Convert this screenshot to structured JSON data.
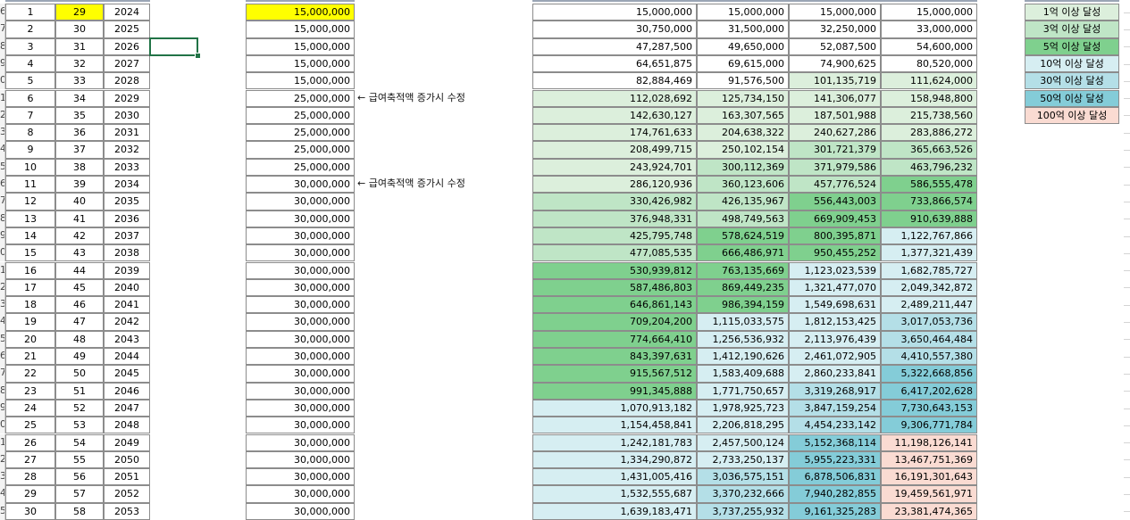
{
  "sheet": {
    "rows": [
      {
        "header": "6",
        "n": "1",
        "age": "29",
        "year": "2024",
        "amount": "15,000,000",
        "a": "15,000,000",
        "b": "15,000,000",
        "c": "15,000,000",
        "d": "15,000,000"
      },
      {
        "header": "7",
        "n": "2",
        "age": "30",
        "year": "2025",
        "amount": "15,000,000",
        "a": "30,750,000",
        "b": "31,500,000",
        "c": "32,250,000",
        "d": "33,000,000"
      },
      {
        "header": "8",
        "n": "3",
        "age": "31",
        "year": "2026",
        "amount": "15,000,000",
        "a": "47,287,500",
        "b": "49,650,000",
        "c": "52,087,500",
        "d": "54,600,000"
      },
      {
        "header": "9",
        "n": "4",
        "age": "32",
        "year": "2027",
        "amount": "15,000,000",
        "a": "64,651,875",
        "b": "69,615,000",
        "c": "74,900,625",
        "d": "80,520,000"
      },
      {
        "header": "0",
        "n": "5",
        "age": "33",
        "year": "2028",
        "amount": "15,000,000",
        "a": "82,884,469",
        "b": "91,576,500",
        "c": "101,135,719",
        "d": "111,624,000"
      },
      {
        "header": "1",
        "n": "6",
        "age": "34",
        "year": "2029",
        "amount": "25,000,000",
        "a": "112,028,692",
        "b": "125,734,150",
        "c": "141,306,077",
        "d": "158,948,800"
      },
      {
        "header": "2",
        "n": "7",
        "age": "35",
        "year": "2030",
        "amount": "25,000,000",
        "a": "142,630,127",
        "b": "163,307,565",
        "c": "187,501,988",
        "d": "215,738,560"
      },
      {
        "header": "3",
        "n": "8",
        "age": "36",
        "year": "2031",
        "amount": "25,000,000",
        "a": "174,761,633",
        "b": "204,638,322",
        "c": "240,627,286",
        "d": "283,886,272"
      },
      {
        "header": "4",
        "n": "9",
        "age": "37",
        "year": "2032",
        "amount": "25,000,000",
        "a": "208,499,715",
        "b": "250,102,154",
        "c": "301,721,379",
        "d": "365,663,526"
      },
      {
        "header": "5",
        "n": "10",
        "age": "38",
        "year": "2033",
        "amount": "25,000,000",
        "a": "243,924,701",
        "b": "300,112,369",
        "c": "371,979,586",
        "d": "463,796,232"
      },
      {
        "header": "6",
        "n": "11",
        "age": "39",
        "year": "2034",
        "amount": "30,000,000",
        "a": "286,120,936",
        "b": "360,123,606",
        "c": "457,776,524",
        "d": "586,555,478"
      },
      {
        "header": "7",
        "n": "12",
        "age": "40",
        "year": "2035",
        "amount": "30,000,000",
        "a": "330,426,982",
        "b": "426,135,967",
        "c": "556,443,003",
        "d": "733,866,574"
      },
      {
        "header": "8",
        "n": "13",
        "age": "41",
        "year": "2036",
        "amount": "30,000,000",
        "a": "376,948,331",
        "b": "498,749,563",
        "c": "669,909,453",
        "d": "910,639,888"
      },
      {
        "header": "9",
        "n": "14",
        "age": "42",
        "year": "2037",
        "amount": "30,000,000",
        "a": "425,795,748",
        "b": "578,624,519",
        "c": "800,395,871",
        "d": "1,122,767,866"
      },
      {
        "header": "0",
        "n": "15",
        "age": "43",
        "year": "2038",
        "amount": "30,000,000",
        "a": "477,085,535",
        "b": "666,486,971",
        "c": "950,455,252",
        "d": "1,377,321,439"
      },
      {
        "header": "1",
        "n": "16",
        "age": "44",
        "year": "2039",
        "amount": "30,000,000",
        "a": "530,939,812",
        "b": "763,135,669",
        "c": "1,123,023,539",
        "d": "1,682,785,727"
      },
      {
        "header": "2",
        "n": "17",
        "age": "45",
        "year": "2040",
        "amount": "30,000,000",
        "a": "587,486,803",
        "b": "869,449,235",
        "c": "1,321,477,070",
        "d": "2,049,342,872"
      },
      {
        "header": "3",
        "n": "18",
        "age": "46",
        "year": "2041",
        "amount": "30,000,000",
        "a": "646,861,143",
        "b": "986,394,159",
        "c": "1,549,698,631",
        "d": "2,489,211,447"
      },
      {
        "header": "4",
        "n": "19",
        "age": "47",
        "year": "2042",
        "amount": "30,000,000",
        "a": "709,204,200",
        "b": "1,115,033,575",
        "c": "1,812,153,425",
        "d": "3,017,053,736"
      },
      {
        "header": "5",
        "n": "20",
        "age": "48",
        "year": "2043",
        "amount": "30,000,000",
        "a": "774,664,410",
        "b": "1,256,536,932",
        "c": "2,113,976,439",
        "d": "3,650,464,484"
      },
      {
        "header": "6",
        "n": "21",
        "age": "49",
        "year": "2044",
        "amount": "30,000,000",
        "a": "843,397,631",
        "b": "1,412,190,626",
        "c": "2,461,072,905",
        "d": "4,410,557,380"
      },
      {
        "header": "7",
        "n": "22",
        "age": "50",
        "year": "2045",
        "amount": "30,000,000",
        "a": "915,567,512",
        "b": "1,583,409,688",
        "c": "2,860,233,841",
        "d": "5,322,668,856"
      },
      {
        "header": "8",
        "n": "23",
        "age": "51",
        "year": "2046",
        "amount": "30,000,000",
        "a": "991,345,888",
        "b": "1,771,750,657",
        "c": "3,319,268,917",
        "d": "6,417,202,628"
      },
      {
        "header": "9",
        "n": "24",
        "age": "52",
        "year": "2047",
        "amount": "30,000,000",
        "a": "1,070,913,182",
        "b": "1,978,925,723",
        "c": "3,847,159,254",
        "d": "7,730,643,153"
      },
      {
        "header": "0",
        "n": "25",
        "age": "53",
        "year": "2048",
        "amount": "30,000,000",
        "a": "1,154,458,841",
        "b": "2,206,818,295",
        "c": "4,454,233,142",
        "d": "9,306,771,784"
      },
      {
        "header": "1",
        "n": "26",
        "age": "54",
        "year": "2049",
        "amount": "30,000,000",
        "a": "1,242,181,783",
        "b": "2,457,500,124",
        "c": "5,152,368,114",
        "d": "11,198,126,141"
      },
      {
        "header": "2",
        "n": "27",
        "age": "55",
        "year": "2050",
        "amount": "30,000,000",
        "a": "1,334,290,872",
        "b": "2,733,250,137",
        "c": "5,955,223,331",
        "d": "13,467,751,369"
      },
      {
        "header": "3",
        "n": "28",
        "age": "56",
        "year": "2051",
        "amount": "30,000,000",
        "a": "1,431,005,416",
        "b": "3,036,575,151",
        "c": "6,878,506,831",
        "d": "16,191,301,643"
      },
      {
        "header": "4",
        "n": "29",
        "age": "57",
        "year": "2052",
        "amount": "30,000,000",
        "a": "1,532,555,687",
        "b": "3,370,232,666",
        "c": "7,940,282,855",
        "d": "19,459,561,971"
      },
      {
        "header": "5",
        "n": "30",
        "age": "58",
        "year": "2053",
        "amount": "30,000,000",
        "a": "1,639,183,471",
        "b": "3,737,255,932",
        "c": "9,161,325,283",
        "d": "23,381,474,365"
      }
    ],
    "notes": [
      {
        "row": 5,
        "text": "← 급여축적액 증가시 수정"
      },
      {
        "row": 10,
        "text": "← 급여축적액 증가시 수정"
      }
    ],
    "legend": [
      {
        "label": "1억 이상 달성",
        "color": "#dcefdc"
      },
      {
        "label": "3억 이상 달성",
        "color": "#bfe5c6"
      },
      {
        "label": "5억 이상 달성",
        "color": "#7fd08e"
      },
      {
        "label": "10억 이상 달성",
        "color": "#d6eef2"
      },
      {
        "label": "30억 이상 달성",
        "color": "#b4dfe7"
      },
      {
        "label": "50억 이상 달성",
        "color": "#84ccd8"
      },
      {
        "label": "100억 이상 달성",
        "color": "#fadbd2"
      }
    ],
    "colors": {
      "highlight_yellow": "#ffff00",
      "selection": "#217346"
    }
  }
}
